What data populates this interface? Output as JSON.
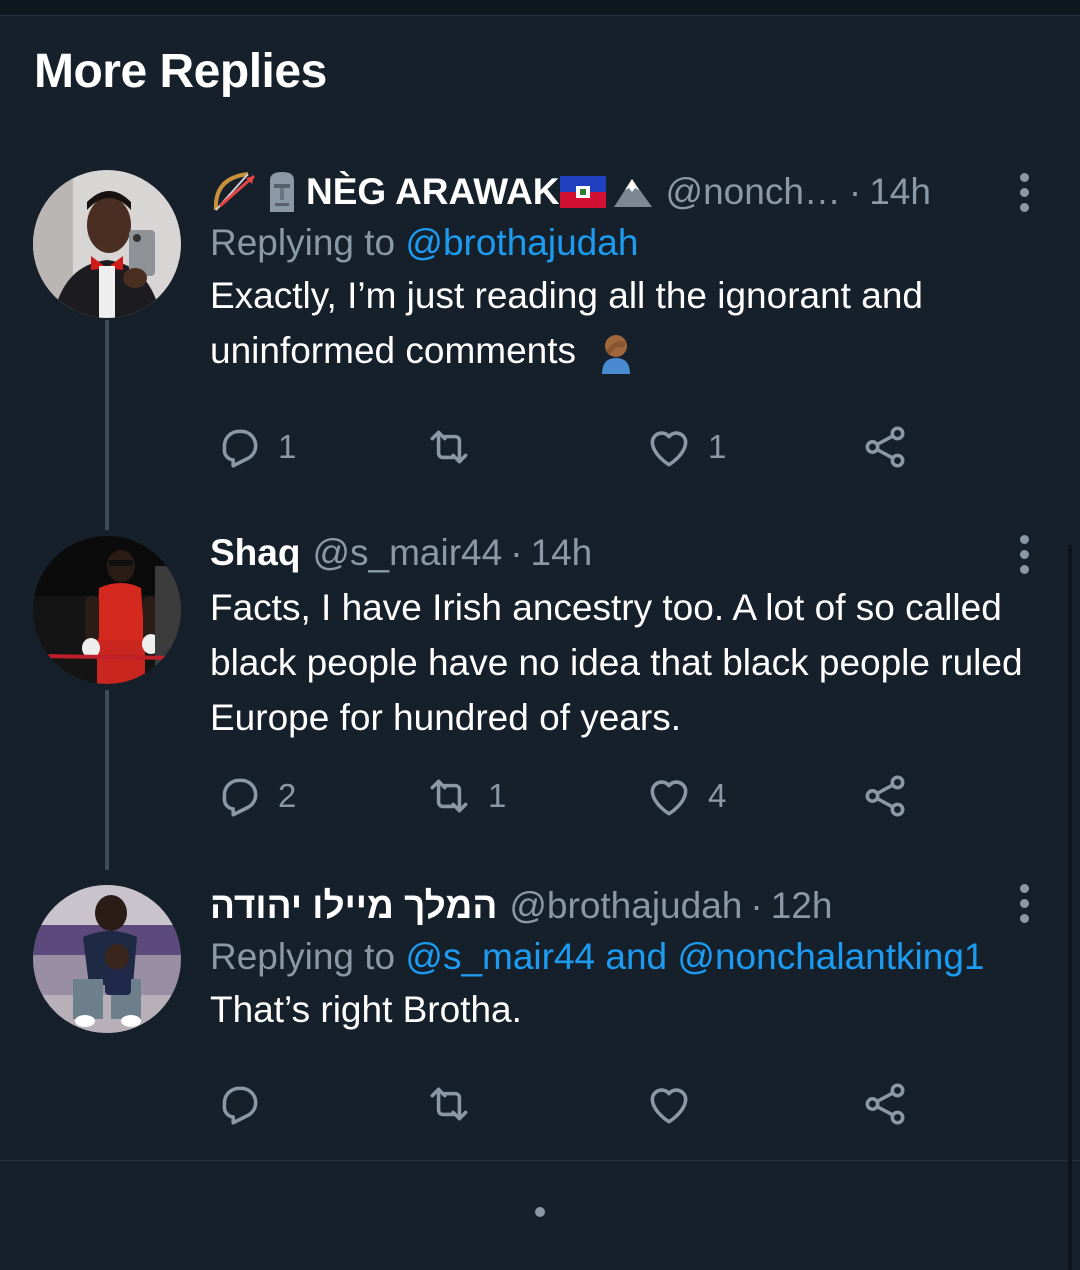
{
  "section_title": "More Replies",
  "tweets": [
    {
      "name": "NÈG ARAWAK",
      "name_prefix_emojis": [
        "bow-and-arrow",
        "moai"
      ],
      "name_suffix_emojis": [
        "haiti-flag",
        "mountain"
      ],
      "handle": "@nonch…",
      "time": "14h",
      "replying_prefix": "Replying to",
      "replying_to": "@brothajudah",
      "text": "Exactly, I’m just reading all the ignorant and uninformed comments",
      "text_emoji": "person-facepalming",
      "stats": {
        "replies": "1",
        "retweets": "",
        "likes": "1"
      }
    },
    {
      "name": "Shaq",
      "handle": "@s_mair44",
      "time": "14h",
      "text": "Facts, I have Irish ancestry too. A lot of so called black people have no idea that black people ruled Europe for hundred of years.",
      "stats": {
        "replies": "2",
        "retweets": "1",
        "likes": "4"
      }
    },
    {
      "name": "המלך מיילו יהודה",
      "handle": "@brothajudah",
      "time": "12h",
      "replying_prefix": "Replying to",
      "replying_to": "@s_mair44 and @nonchalantking1",
      "text": "That’s right Brotha.",
      "stats": {
        "replies": "",
        "retweets": "",
        "likes": ""
      }
    }
  ],
  "colors": {
    "background": "#15202b",
    "secondary_text": "#8b98a5",
    "link": "#1d9bf0",
    "thread_line": "#3d4d5c"
  }
}
